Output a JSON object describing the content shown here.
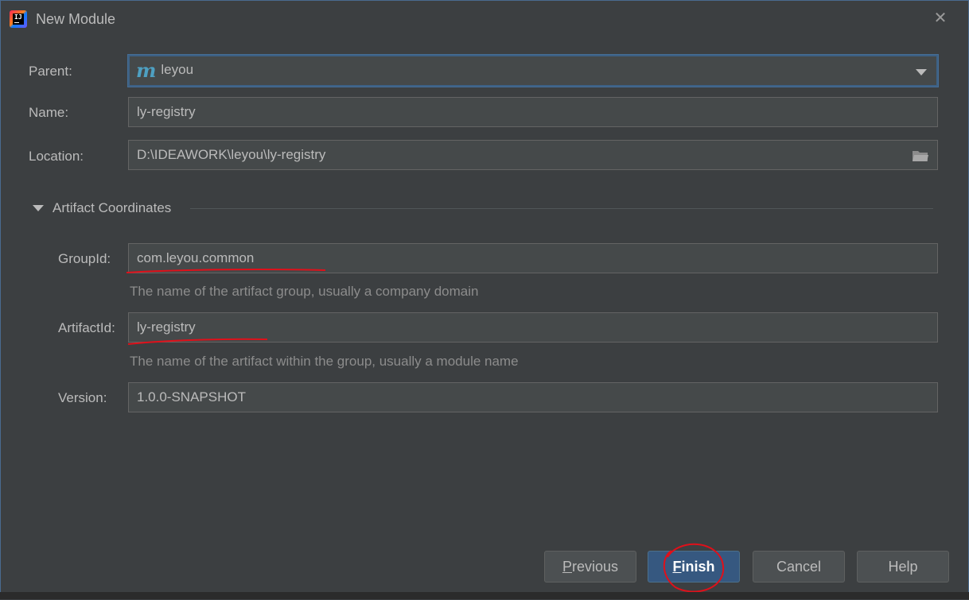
{
  "window": {
    "title": "New Module",
    "close_icon": "close-icon"
  },
  "form": {
    "parent": {
      "label": "Parent:",
      "value": "leyou",
      "logo_text": "m"
    },
    "name": {
      "label": "Name:",
      "value": "ly-registry"
    },
    "location": {
      "label": "Location:",
      "value": "D:\\IDEAWORK\\leyou\\ly-registry"
    }
  },
  "artifact": {
    "section_title": "Artifact Coordinates",
    "group_id": {
      "label": "GroupId:",
      "value": "com.leyou.common",
      "hint": "The name of the artifact group, usually a company domain"
    },
    "artifact_id": {
      "label": "ArtifactId:",
      "value": "ly-registry",
      "hint": "The name of the artifact within the group, usually a module name"
    },
    "version": {
      "label": "Version:",
      "value": "1.0.0-SNAPSHOT"
    }
  },
  "buttons": {
    "previous": {
      "mnemonic": "P",
      "rest": "revious"
    },
    "finish": {
      "mnemonic": "F",
      "rest": "inish"
    },
    "cancel": "Cancel",
    "help": "Help"
  },
  "colors": {
    "annotation": "#e0101a",
    "accent": "#365880"
  }
}
